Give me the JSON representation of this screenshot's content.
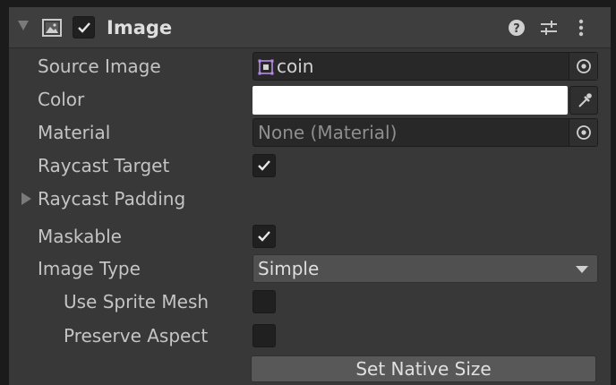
{
  "component": {
    "title": "Image",
    "enabled": true,
    "header_icons": [
      "image-component-icon",
      "help-icon",
      "preset-sliders-icon",
      "more-vert-icon"
    ]
  },
  "fields": {
    "source_image": {
      "label": "Source Image",
      "value": "coin",
      "icon": "sprite-icon"
    },
    "color": {
      "label": "Color",
      "value": "#ffffff"
    },
    "material": {
      "label": "Material",
      "value": "None (Material)"
    },
    "raycast_target": {
      "label": "Raycast Target",
      "checked": true
    },
    "raycast_padding": {
      "label": "Raycast Padding",
      "expanded": false
    },
    "maskable": {
      "label": "Maskable",
      "checked": true
    },
    "image_type": {
      "label": "Image Type",
      "value": "Simple"
    },
    "use_sprite_mesh": {
      "label": "Use Sprite Mesh",
      "checked": false
    },
    "preserve_aspect": {
      "label": "Preserve Aspect",
      "checked": false
    }
  },
  "buttons": {
    "set_native_size": "Set Native Size"
  },
  "colors": {
    "panel": "#383838",
    "header": "#3e3e3e",
    "field": "#282828",
    "sprite_accent": "#b58be6"
  }
}
